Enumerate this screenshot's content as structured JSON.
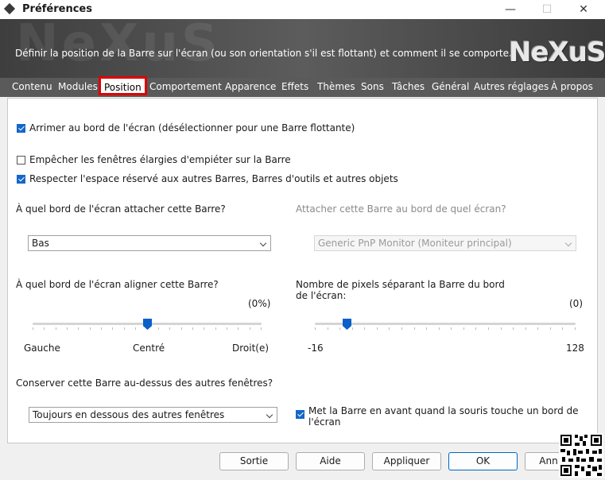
{
  "window": {
    "title": "Préférences",
    "minimize_glyph": "—",
    "maximize_glyph": "☐",
    "close_glyph": "✕"
  },
  "banner": {
    "description": "Définir la position de la Barre sur l'écran (ou son orientation s'il est flottant) et comment il se comporte.",
    "logo_text": "NeXuS",
    "ghost_text": "NeXuS"
  },
  "tabs": [
    {
      "label": "Contenu"
    },
    {
      "label": "Modules"
    },
    {
      "label": "Position",
      "active": true
    },
    {
      "label": "Comportement"
    },
    {
      "label": "Apparence"
    },
    {
      "label": "Effets"
    },
    {
      "label": "Thèmes"
    },
    {
      "label": "Sons"
    },
    {
      "label": "Tâches"
    },
    {
      "label": "Général"
    },
    {
      "label": "Autres réglages"
    },
    {
      "label": "À propos"
    }
  ],
  "options": {
    "dock_edge": {
      "label": "Arrimer au bord de l'écran (désélectionner pour une Barre flottante)",
      "checked": true
    },
    "prevent_overlap": {
      "label": "Empêcher les fenêtres élargies d'empiéter sur la Barre",
      "checked": false
    },
    "respect_space": {
      "label": "Respecter l'espace réservé aux autres Barres, Barres d'outils et autres objets",
      "checked": true
    }
  },
  "edge": {
    "question": "À quel bord de l'écran attacher cette Barre?",
    "value": "Bas"
  },
  "monitor": {
    "question": "Attacher cette Barre au bord de quel écran?",
    "value": "Generic PnP Monitor (Moniteur principal)",
    "disabled": true
  },
  "align": {
    "question": "À quel bord de l'écran aligner cette Barre?",
    "value_text": "(0%)",
    "value": 0,
    "min_label": "Gauche",
    "mid_label": "Centré",
    "max_label": "Droit(e)"
  },
  "pixels": {
    "question_line1": "Nombre de pixels séparant la Barre du bord",
    "question_line2": "de l'écran:",
    "value_text": "(0)",
    "value": 0,
    "min": -16,
    "max": 128,
    "min_label": "-16",
    "max_label": "128"
  },
  "zorder": {
    "question": "Conserver cette Barre au-dessus des autres fenêtres?",
    "value": "Toujours en dessous des autres fenêtres"
  },
  "mouse_front": {
    "label_line1": "Met la Barre en avant quand la souris touche un bord de",
    "label_line2": "l'écran",
    "checked": true
  },
  "buttons": {
    "exit": "Sortie",
    "help": "Aide",
    "apply": "Appliquer",
    "ok": "OK",
    "cancel": "Ann"
  },
  "colors": {
    "accent": "#1467c9",
    "active_tab_outline": "#e00000",
    "banner_dark": "#3e3e3e",
    "tab_bar": "#5a5a5a"
  }
}
